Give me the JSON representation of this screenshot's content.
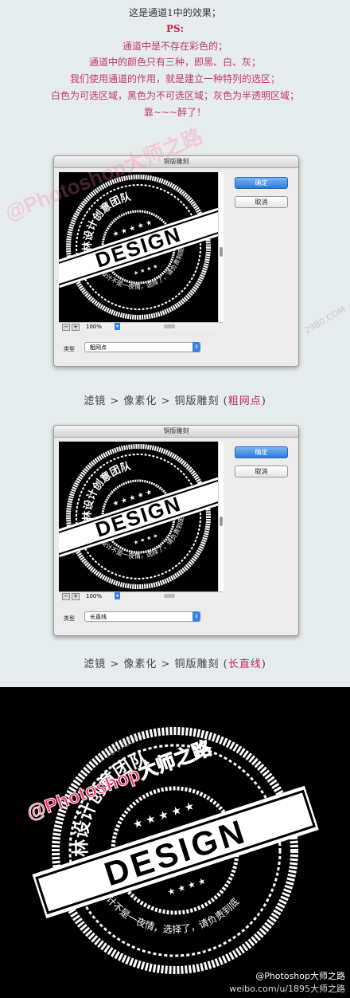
{
  "intro": {
    "line1": "这是通道1中的效果；",
    "ps": "PS:",
    "line2": "通道中是不存在彩色的；",
    "line3": "通道中的颜色只有三种，即黑、白、灰；",
    "line4": "我们使用通道的作用，就是建立一种特列的选区；",
    "line5": "白色为可选区域，黑色为不可选区域；灰色为半透明区域；",
    "line6": "靠~~~醉了！"
  },
  "stamp": {
    "top_text": "小林设计创意团队",
    "main_word": "DESIGN",
    "bottom_text": "设计不是一夜情，选择了，请负责到底"
  },
  "dialog1": {
    "title": "铜版雕刻",
    "ok_label": "确定",
    "cancel_label": "取消",
    "zoom_minus": "−",
    "zoom_plus": "+",
    "zoom": "100%",
    "zoom_arrow": "▾",
    "type_label": "类型",
    "type_value": "粗网点",
    "select_arrow": "⇕"
  },
  "caption1": {
    "prefix": "滤镜 > 像素化 > 铜版雕刻 (",
    "highlight": "粗网点",
    "suffix": ")"
  },
  "dialog2": {
    "title": "铜版雕刻",
    "ok_label": "确定",
    "cancel_label": "取消",
    "zoom_minus": "−",
    "zoom_plus": "+",
    "zoom": "100%",
    "zoom_arrow": "▾",
    "type_label": "类型",
    "type_value": "长直线",
    "select_arrow": "⇕"
  },
  "caption2": {
    "prefix": "滤镜 > 像素化 > 铜版雕刻 (",
    "highlight": "长直线",
    "suffix": ")"
  },
  "watermarks": {
    "pink_top": "@Photoshop大师之路",
    "site_top": "2980.COM",
    "pink_bottom": "@Photoshop大师之路",
    "site_bottom": "2980.COM"
  },
  "credits": {
    "line1": "@Photoshop大师之路",
    "line2": "weibo.com/u/1895大师之路"
  },
  "colors": {
    "accent_pink": "#c9245a",
    "ok_blue": "#2a7ad8"
  }
}
